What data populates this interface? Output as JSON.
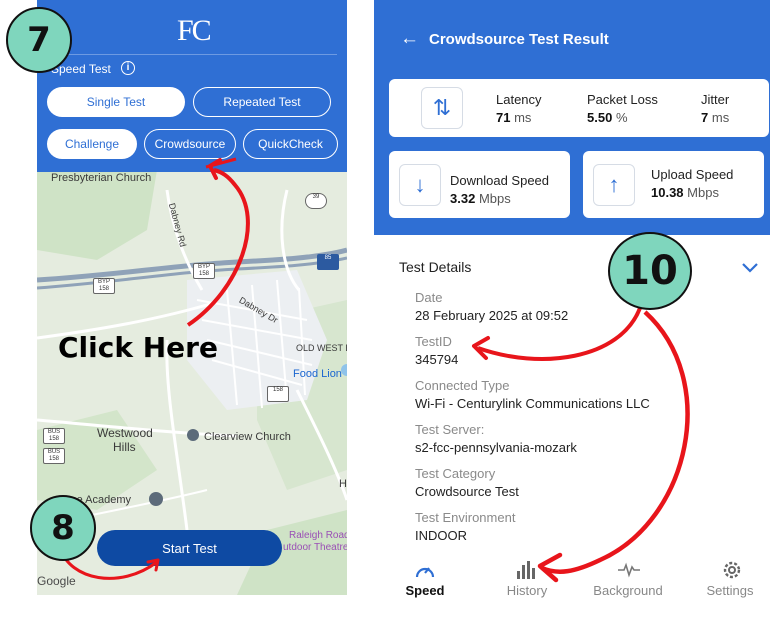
{
  "left_app": {
    "logo": "FC",
    "speed_test_label": "Speed Test",
    "info_glyph": "i",
    "buttons": {
      "single_test": "Single Test",
      "repeated_test": "Repeated Test",
      "challenge": "Challenge",
      "crowdsource": "Crowdsource",
      "quickcheck": "QuickCheck"
    },
    "start_test": "Start Test",
    "map": {
      "labels": {
        "presbyterian": "Presbyterian Church",
        "dabney_rd": "Dabney Rd",
        "dabney_dr": "Dabney Dr",
        "old_west": "OLD WEST E",
        "food_lion": "Food Lion",
        "westwood": "Westwood",
        "hills": "Hills",
        "clearview": "Clearview Church",
        "academy": "nce Academy",
        "raleigh1": "Raleigh Road",
        "raleigh2": "utdoor Theatre",
        "he": "He",
        "google": "Google"
      },
      "shields": {
        "s39": "39",
        "s85": "85",
        "byp1": "BYP 158",
        "byp2": "BYP 158",
        "bus1": "BUS 158",
        "bus2": "BUS 158",
        "s158": "158"
      }
    }
  },
  "right_app": {
    "title": "Crowdsource Test Result",
    "back_glyph": "←",
    "latency": {
      "label": "Latency",
      "value": "71",
      "unit": "ms"
    },
    "packet_loss": {
      "label": "Packet Loss",
      "value": "5.50",
      "unit": "%"
    },
    "jitter": {
      "label": "Jitter",
      "value": "7",
      "unit": "ms"
    },
    "download": {
      "label": "Download Speed",
      "value": "3.32",
      "unit": "Mbps"
    },
    "upload": {
      "label": "Upload Speed",
      "value": "10.38",
      "unit": "Mbps"
    },
    "test_details_title": "Test Details",
    "details": [
      {
        "label": "Date",
        "value": "28 February 2025 at 09:52"
      },
      {
        "label": "TestID",
        "value": "345794"
      },
      {
        "label": "Connected Type",
        "value": "Wi-Fi - Centurylink Communications LLC"
      },
      {
        "label": "Test Server:",
        "value": "s2-fcc-pennsylvania-mozark"
      },
      {
        "label": "Test Category",
        "value": "Crowdsource Test"
      },
      {
        "label": "Test Environment",
        "value": "INDOOR"
      }
    ],
    "nav": {
      "speed": "Speed",
      "history": "History",
      "background": "Background",
      "settings": "Settings"
    }
  },
  "annotations": {
    "step7": "7",
    "step8": "8",
    "step10": "10",
    "click_here": "Click Here"
  },
  "colors": {
    "primary_blue": "#2f6fd4",
    "start_button": "#0e4aa3",
    "badge_fill": "#7fd6bd",
    "arrow_red": "#e8151b"
  }
}
